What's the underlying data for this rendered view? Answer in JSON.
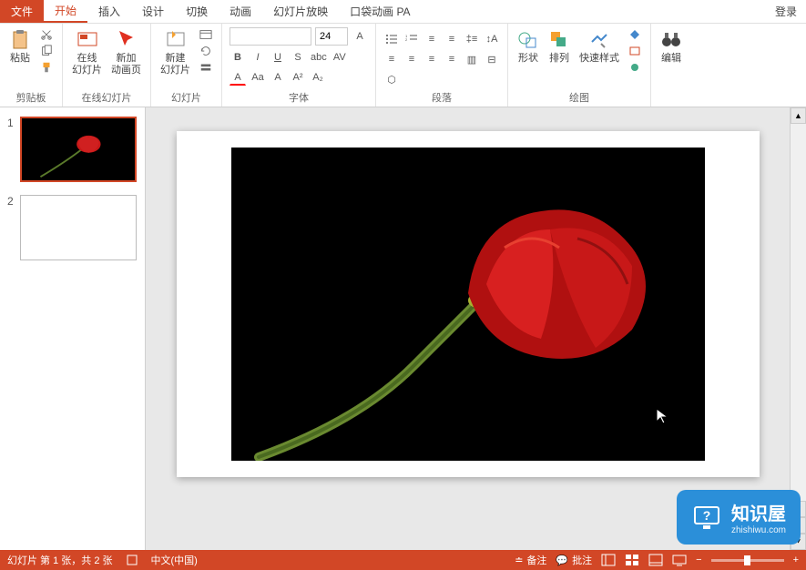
{
  "menu": {
    "file": "文件",
    "tabs": [
      "开始",
      "插入",
      "设计",
      "切换",
      "动画",
      "幻灯片放映",
      "口袋动画 PA"
    ],
    "active_index": 0,
    "login": "登录"
  },
  "ribbon": {
    "clipboard": {
      "paste": "粘贴",
      "label": "剪贴板"
    },
    "online_slides": {
      "online": "在线\n幻灯片",
      "new_anim": "新加\n动画页",
      "label": "在线幻灯片"
    },
    "slides": {
      "new_slide": "新建\n幻灯片",
      "label": "幻灯片"
    },
    "font": {
      "size": "24",
      "bold": "B",
      "italic": "I",
      "underline": "U",
      "strike": "S",
      "label": "字体"
    },
    "paragraph": {
      "label": "段落"
    },
    "drawing": {
      "shapes": "形状",
      "arrange": "排列",
      "quick": "快速样式",
      "label": "绘图"
    },
    "editing": {
      "edit": "编辑",
      "label": ""
    }
  },
  "sidebar": {
    "slides": [
      {
        "num": "1",
        "selected": true
      },
      {
        "num": "2",
        "selected": false
      }
    ]
  },
  "statusbar": {
    "slide_info": "幻灯片 第 1 张，共 2 张",
    "language": "中文(中国)",
    "notes": "备注",
    "comments": "批注",
    "zoom_minus": "−",
    "zoom_plus": "+"
  },
  "watermark": {
    "title": "知识屋",
    "url": "zhishiwu.com"
  }
}
